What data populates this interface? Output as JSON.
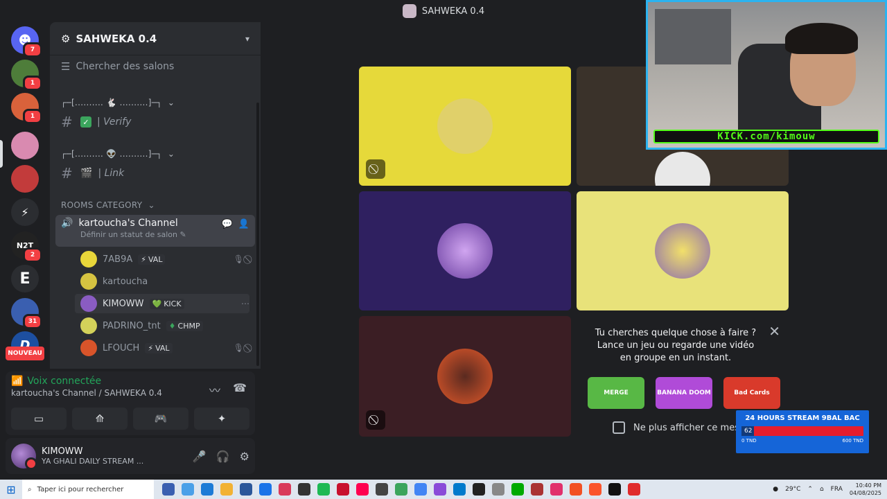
{
  "window": {
    "title": "SAHWEKA 0.4"
  },
  "servers": [
    {
      "name": "discord-home",
      "badge": "7",
      "color": "#5865f2"
    },
    {
      "name": "turtle-server",
      "badge": "1",
      "color": "#4e7d3a"
    },
    {
      "name": "robot-server",
      "badge": "1",
      "color": "#d9623b"
    },
    {
      "name": "sahweka-server",
      "badge": "",
      "color": "#d98ab0"
    },
    {
      "name": "kimoww-server",
      "badge": "",
      "color": "#c23b3b"
    },
    {
      "name": "logo-server",
      "badge": "",
      "color": "#2b2d31"
    },
    {
      "name": "n2t-server",
      "badge": "2",
      "color": "#222"
    },
    {
      "name": "e-server",
      "badge": "",
      "color": "#2b2d31"
    },
    {
      "name": "avatar-server",
      "badge": "31",
      "color": "#3a5fb0"
    },
    {
      "name": "d-server",
      "badge": "",
      "color": "#1d4fa0"
    }
  ],
  "server_labels": {
    "n2t": "N2T",
    "e": "E",
    "d": "D"
  },
  "nouveau_label": "NOUVEAU",
  "sidebar": {
    "guild_name": "SAHWEKA 0.4",
    "search_channels": "Chercher des salons",
    "category1": "┌─[.......... 🐇 ..........]─┐",
    "verify_channel": "| Verify",
    "category2": "┌─[.......... 👽 ..........]─┐",
    "link_channel": "| Link",
    "rooms_category": "ROOMS CATEGORY",
    "voice_channel": "kartoucha's Channel",
    "voice_status": "Définir un statut de salon",
    "members": [
      {
        "name": "7AB9A",
        "tag": "VAL",
        "tag_icon": "⚡",
        "avatar": "#e8d63a"
      },
      {
        "name": "kartoucha",
        "tag": "",
        "tag_icon": "",
        "avatar": "#d6c341"
      },
      {
        "name": "KIMOWW",
        "tag": "KICK",
        "tag_icon": "💚",
        "avatar": "#8a5cc2"
      },
      {
        "name": "PADRINO_tnt",
        "tag": "CHMP",
        "tag_icon": "♦",
        "avatar": "#d4d25a"
      },
      {
        "name": "LFOUCH",
        "tag": "VAL",
        "tag_icon": "⚡",
        "avatar": "#d8542a"
      }
    ]
  },
  "voice_panel": {
    "status": "Voix connectée",
    "location": "kartoucha's Channel / SAHWEKA 0.4"
  },
  "user_panel": {
    "name": "KIMOWW",
    "status": "YA GHALI DAILY STREAM ..."
  },
  "stage": {
    "tiles": [
      {
        "name": "tile-1",
        "bg": "#e6d93a",
        "avatar": "#f0e26b",
        "video_off": true
      },
      {
        "name": "tile-2",
        "bg": "#3a322a",
        "avatar": "#ddd",
        "video_off": false
      },
      {
        "name": "tile-3",
        "bg": "#2f2060",
        "avatar": "#b78ae0",
        "video_off": false
      },
      {
        "name": "tile-4",
        "bg": "#e8e27a",
        "avatar": "#e8d650",
        "video_off": false
      },
      {
        "name": "tile-5",
        "bg": "#3b1e24",
        "avatar": "#e0582a",
        "video_off": true
      }
    ],
    "activity": {
      "text": "Tu cherches quelque chose à faire ? Lance un jeu ou regarde une vidéo en groupe en un instant.",
      "games": [
        {
          "label": "MERGE",
          "color": "#58b845"
        },
        {
          "label": "BANANA DOOM",
          "color": "#b04bd8"
        },
        {
          "label": "Bad Cards",
          "color": "#d93a2b"
        }
      ],
      "checkbox_label": "Ne plus afficher ce mess"
    }
  },
  "overlay": {
    "cam_caption": "KICK.com/kimouw",
    "goal_title": "24 HOURS STREAM 9BAL BAC",
    "goal_value": "62",
    "goal_min": "0 TND",
    "goal_max": "600 TND",
    "goal_progress": 0.103
  },
  "taskbar": {
    "search_placeholder": "Taper ici pour rechercher",
    "weather": "29°C",
    "lang": "FRA",
    "time": "10:40 PM",
    "date": "04/08/2025"
  }
}
